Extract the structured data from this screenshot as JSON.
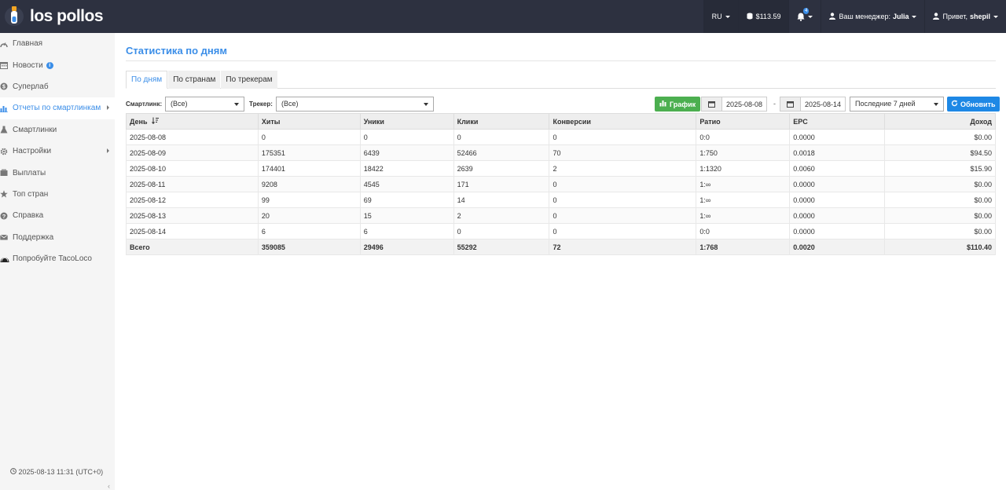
{
  "brand": {
    "name": "los pollos"
  },
  "topbar": {
    "lang": "RU",
    "balance": "$113.59",
    "notifications_count": "4",
    "manager_label": "Ваш менеджер:",
    "manager_name": "Julia",
    "greeting": "Привет,",
    "username": "shepil"
  },
  "sidebar": {
    "items": [
      {
        "label": "Главная",
        "icon": "dashboard-icon"
      },
      {
        "label": "Новости",
        "icon": "calendar-icon"
      },
      {
        "label": "Суперлаб",
        "icon": "dollar-icon"
      },
      {
        "label": "Отчеты по смартлинкам",
        "icon": "bar-chart-icon"
      },
      {
        "label": "Смартлинки",
        "icon": "flask-icon"
      },
      {
        "label": "Настройки",
        "icon": "gear-icon"
      },
      {
        "label": "Выплаты",
        "icon": "payments-icon"
      },
      {
        "label": "Топ стран",
        "icon": "star-icon"
      },
      {
        "label": "Справка",
        "icon": "question-icon"
      },
      {
        "label": "Поддержка",
        "icon": "envelope-icon"
      },
      {
        "label": "Попробуйте TacoLoco",
        "icon": "taco-icon"
      }
    ],
    "time": "2025-08-13 11:31 (UTC+0)"
  },
  "main": {
    "title": "Статистика по дням",
    "tabs": [
      "По дням",
      "По странам",
      "По трекерам"
    ],
    "filters": {
      "smartlink_label": "Смартлинк:",
      "smartlink_value": "(Все)",
      "tracker_label": "Трекер:",
      "tracker_value": "(Все)",
      "graph_button": "График",
      "date_from": "2025-08-08",
      "date_to": "2025-08-14",
      "period": "Последние 7 дней",
      "refresh_button": "Обновить"
    },
    "table": {
      "headers": [
        "День",
        "Хиты",
        "Уники",
        "Клики",
        "Конверсии",
        "Ратио",
        "EPC",
        "Доход"
      ],
      "rows": [
        [
          "2025-08-08",
          "0",
          "0",
          "0",
          "0",
          "0:0",
          "0.0000",
          "$0.00"
        ],
        [
          "2025-08-09",
          "175351",
          "6439",
          "52466",
          "70",
          "1:750",
          "0.0018",
          "$94.50"
        ],
        [
          "2025-08-10",
          "174401",
          "18422",
          "2639",
          "2",
          "1:1320",
          "0.0060",
          "$15.90"
        ],
        [
          "2025-08-11",
          "9208",
          "4545",
          "171",
          "0",
          "1:∞",
          "0.0000",
          "$0.00"
        ],
        [
          "2025-08-12",
          "99",
          "69",
          "14",
          "0",
          "1:∞",
          "0.0000",
          "$0.00"
        ],
        [
          "2025-08-13",
          "20",
          "15",
          "2",
          "0",
          "1:∞",
          "0.0000",
          "$0.00"
        ],
        [
          "2025-08-14",
          "6",
          "6",
          "0",
          "0",
          "0:0",
          "0.0000",
          "$0.00"
        ]
      ],
      "total": [
        "Всего",
        "359085",
        "29496",
        "55292",
        "72",
        "1:768",
        "0.0020",
        "$110.40"
      ]
    }
  }
}
